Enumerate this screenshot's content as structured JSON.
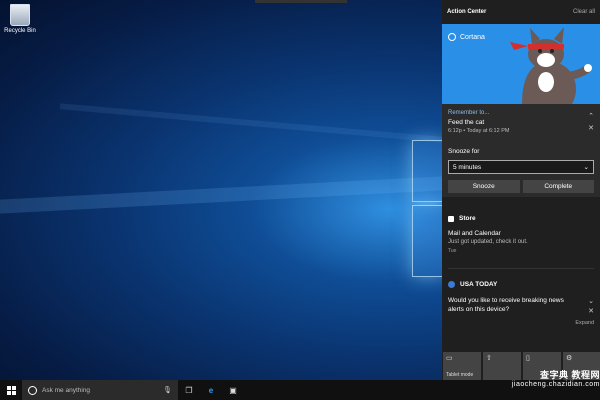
{
  "desktop": {
    "icons": [
      {
        "label": "Recycle Bin",
        "icon": "recycle-bin-icon"
      }
    ]
  },
  "action_center": {
    "title": "Action Center",
    "clear_all": "Clear all",
    "cortana": {
      "app_name": "Cortana",
      "reminder_heading": "Remember to...",
      "reminder_text": "Feed the cat",
      "reminder_time": "6:12p • Today at 6:12 PM",
      "snooze_label": "Snooze for",
      "snooze_value": "5 minutes",
      "snooze_button": "Snooze",
      "complete_button": "Complete"
    },
    "store": {
      "app_name": "Store",
      "title": "Mail and Calendar",
      "body": "Just got updated, check it out.",
      "time": "Tue"
    },
    "usa_today": {
      "app_name": "USA TODAY",
      "body": "Would you like to receive breaking news alerts on this device?",
      "expand": "Expand"
    },
    "quick_actions": [
      {
        "label": "Tablet mode",
        "icon": "tablet-mode-icon"
      },
      {
        "label": "",
        "icon": "connect-icon"
      },
      {
        "label": "",
        "icon": "note-icon"
      },
      {
        "label": "",
        "icon": "settings-icon"
      }
    ]
  },
  "taskbar": {
    "search_placeholder": "Ask me anything"
  },
  "watermark": {
    "title": "查字典 教程网",
    "url": "jiaocheng.chazidian.com"
  }
}
